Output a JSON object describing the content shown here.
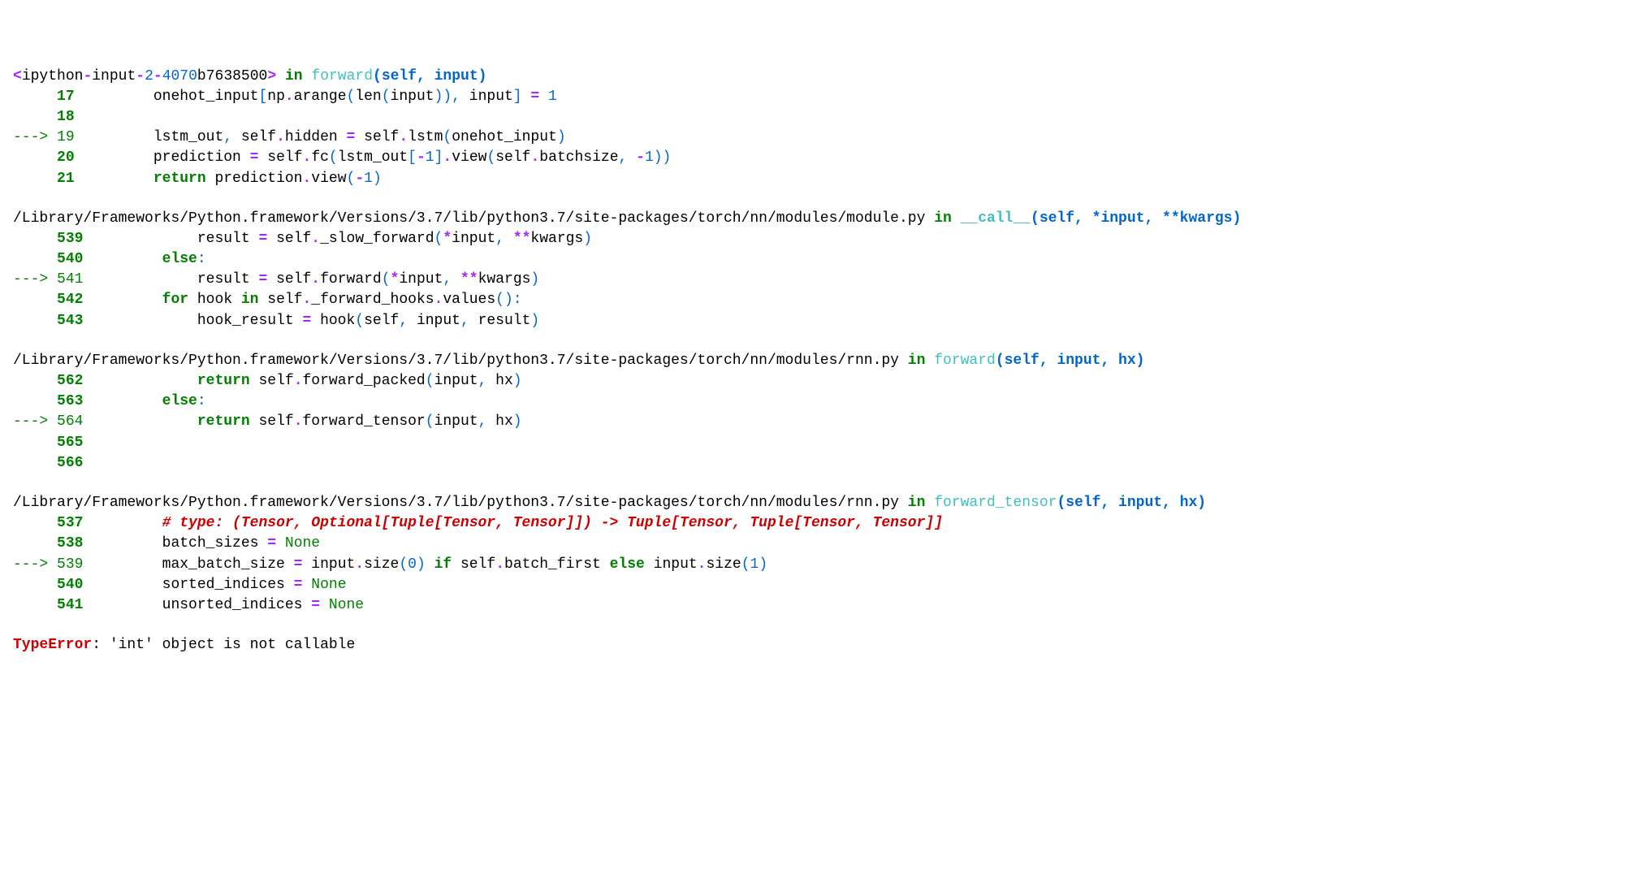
{
  "frames": [
    {
      "location_html": "<span class='op'>&lt;</span><span class='def'>ipython</span><span class='op'>-</span><span class='def'>input</span><span class='op'>-</span><span class='num'>2</span><span class='op'>-</span><span class='num'>4070</span><span class='def'>b7638500</span><span class='op'>&gt;</span> <span class='kw'>in</span> <span class='fn'>forward</span><span class='arg'>(self, input)</span>",
      "lines": [
        {
          "arrow": false,
          "num": "17",
          "html": "onehot_input<span class='paren'>[</span>np<span class='op'>.</span>arange<span class='paren'>(</span>len<span class='paren'>(</span>input<span class='paren'>))</span><span class='paren'>,</span> input<span class='paren'>]</span> <span class='op'>=</span> <span class='num'>1</span>"
        },
        {
          "arrow": false,
          "num": "18",
          "html": ""
        },
        {
          "arrow": true,
          "num": "19",
          "html": "lstm_out<span class='paren'>,</span> self<span class='op'>.</span>hidden <span class='op'>=</span> self<span class='op'>.</span>lstm<span class='paren'>(</span>onehot_input<span class='paren'>)</span>"
        },
        {
          "arrow": false,
          "num": "20",
          "html": "prediction <span class='op'>=</span> self<span class='op'>.</span>fc<span class='paren'>(</span>lstm_out<span class='paren'>[</span><span class='op'>-</span><span class='num'>1</span><span class='paren'>]</span><span class='op'>.</span>view<span class='paren'>(</span>self<span class='op'>.</span>batchsize<span class='paren'>,</span> <span class='op'>-</span><span class='num'>1</span><span class='paren'>))</span>"
        },
        {
          "arrow": false,
          "num": "21",
          "html": "<span class='kw'>return</span> prediction<span class='op'>.</span>view<span class='paren'>(</span><span class='op'>-</span><span class='num'>1</span><span class='paren'>)</span>"
        }
      ]
    },
    {
      "location_html": "/Library/Frameworks/Python.framework/Versions/3.7/lib/python3.7/site-packages/torch/nn/modules/module.py <span class='kw'>in</span> <span class='fncall'>__call__</span><span class='arg'>(self, *input, **kwargs)</span>",
      "lines": [
        {
          "arrow": false,
          "num": "539",
          "html": "    result <span class='op'>=</span> self<span class='op'>.</span>_slow_forward<span class='paren'>(</span><span class='op'>*</span>input<span class='paren'>,</span> <span class='op'>**</span>kwargs<span class='paren'>)</span>"
        },
        {
          "arrow": false,
          "num": "540",
          "html": "<span class='kw'>else</span><span class='paren'>:</span>"
        },
        {
          "arrow": true,
          "num": "541",
          "html": "    result <span class='op'>=</span> self<span class='op'>.</span>forward<span class='paren'>(</span><span class='op'>*</span>input<span class='paren'>,</span> <span class='op'>**</span>kwargs<span class='paren'>)</span>"
        },
        {
          "arrow": false,
          "num": "542",
          "html": "<span class='kw'>for</span> hook <span class='kw'>in</span> self<span class='op'>.</span>_forward_hooks<span class='op'>.</span>values<span class='paren'>():</span>"
        },
        {
          "arrow": false,
          "num": "543",
          "html": "    hook_result <span class='op'>=</span> hook<span class='paren'>(</span>self<span class='paren'>,</span> input<span class='paren'>,</span> result<span class='paren'>)</span>"
        }
      ]
    },
    {
      "location_html": "/Library/Frameworks/Python.framework/Versions/3.7/lib/python3.7/site-packages/torch/nn/modules/rnn.py <span class='kw'>in</span> <span class='fn'>forward</span><span class='arg'>(self, input, hx)</span>",
      "lines": [
        {
          "arrow": false,
          "num": "562",
          "html": "    <span class='kw'>return</span> self<span class='op'>.</span>forward_packed<span class='paren'>(</span>input<span class='paren'>,</span> hx<span class='paren'>)</span>"
        },
        {
          "arrow": false,
          "num": "563",
          "html": "<span class='kw'>else</span><span class='paren'>:</span>"
        },
        {
          "arrow": true,
          "num": "564",
          "html": "    <span class='kw'>return</span> self<span class='op'>.</span>forward_tensor<span class='paren'>(</span>input<span class='paren'>,</span> hx<span class='paren'>)</span>"
        },
        {
          "arrow": false,
          "num": "565",
          "html": ""
        },
        {
          "arrow": false,
          "num": "566",
          "html": ""
        }
      ]
    },
    {
      "location_html": "/Library/Frameworks/Python.framework/Versions/3.7/lib/python3.7/site-packages/torch/nn/modules/rnn.py <span class='kw'>in</span> <span class='fn'>forward_tensor</span><span class='arg'>(self, input, hx)</span>",
      "lines": [
        {
          "arrow": false,
          "num": "537",
          "html": "<span class='comment'># type: (Tensor, Optional[Tuple[Tensor, Tensor]]) -&gt; Tuple[Tensor, Tuple[Tensor, Tensor]]</span>"
        },
        {
          "arrow": false,
          "num": "538",
          "html": "batch_sizes <span class='op'>=</span> <span class='none'>None</span>"
        },
        {
          "arrow": true,
          "num": "539",
          "html": "max_batch_size <span class='op'>=</span> input<span class='op'>.</span>size<span class='paren'>(</span><span class='num'>0</span><span class='paren'>)</span> <span class='kw'>if</span> self<span class='op'>.</span>batch_first <span class='kw'>else</span> input<span class='op'>.</span>size<span class='paren'>(</span><span class='num'>1</span><span class='paren'>)</span>"
        },
        {
          "arrow": false,
          "num": "540",
          "html": "sorted_indices <span class='op'>=</span> <span class='none'>None</span>"
        },
        {
          "arrow": false,
          "num": "541",
          "html": "unsorted_indices <span class='op'>=</span> <span class='none'>None</span>"
        }
      ]
    }
  ],
  "error": {
    "name": "TypeError",
    "message": ": 'int' object is not callable"
  },
  "arrow_sym": "---> ",
  "blank_arrow": "     "
}
